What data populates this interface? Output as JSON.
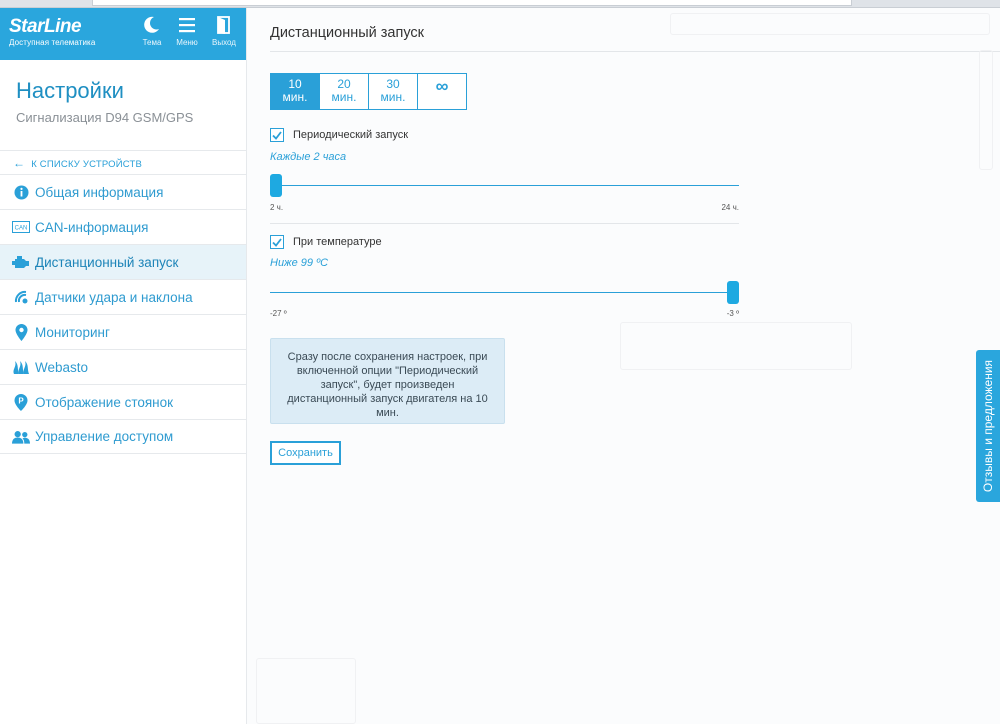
{
  "brand": {
    "name": "StarLine",
    "tagline": "Доступная телематика"
  },
  "topbar": {
    "theme_label": "Тема",
    "menu_label": "Меню",
    "exit_label": "Выход"
  },
  "settings": {
    "title": "Настройки",
    "device": "Сигнализация D94 GSM/GPS",
    "back_label": "К СПИСКУ УСТРОЙСТВ"
  },
  "sidebar": {
    "items": [
      {
        "label": "Общая информация",
        "icon": "info-icon"
      },
      {
        "label": "CAN-информация",
        "icon": "can-icon"
      },
      {
        "label": "Дистанционный запуск",
        "icon": "engine-icon",
        "active": true
      },
      {
        "label": "Датчики удара и наклона",
        "icon": "shock-sensor-icon"
      },
      {
        "label": "Мониторинг",
        "icon": "location-pin-icon"
      },
      {
        "label": "Webasto",
        "icon": "heater-icon"
      },
      {
        "label": "Отображение стоянок",
        "icon": "parking-icon"
      },
      {
        "label": "Управление доступом",
        "icon": "users-icon"
      }
    ]
  },
  "main": {
    "title": "Дистанционный запуск",
    "durations": [
      {
        "value": "10",
        "unit": "мин.",
        "selected": true
      },
      {
        "value": "20",
        "unit": "мин."
      },
      {
        "value": "30",
        "unit": "мин."
      },
      {
        "value": "∞",
        "unit": ""
      }
    ],
    "periodic": {
      "checked": true,
      "label": "Периодический запуск",
      "note": "Каждые 2 часа",
      "slider_min": "2 ч.",
      "slider_max": "24 ч.",
      "level_fraction": 0.0
    },
    "temperature": {
      "checked": true,
      "label": "При температуре",
      "note": "Ниже 99 ºC",
      "slider_min": "-27 º",
      "slider_max": "-3 º",
      "level_fraction": 1.0
    },
    "info_text": "Сразу после сохранения настроек, при включенной опции \"Периодический запуск\", будет произведен дистанционный запуск двигателя на 10 мин.",
    "save_label": "Сохранить"
  },
  "feedback_label": "Отзывы и предложения",
  "colors": {
    "accent": "#2aa6dd",
    "active_bg": "#e7f3f9",
    "info_bg": "#dcecf6"
  }
}
